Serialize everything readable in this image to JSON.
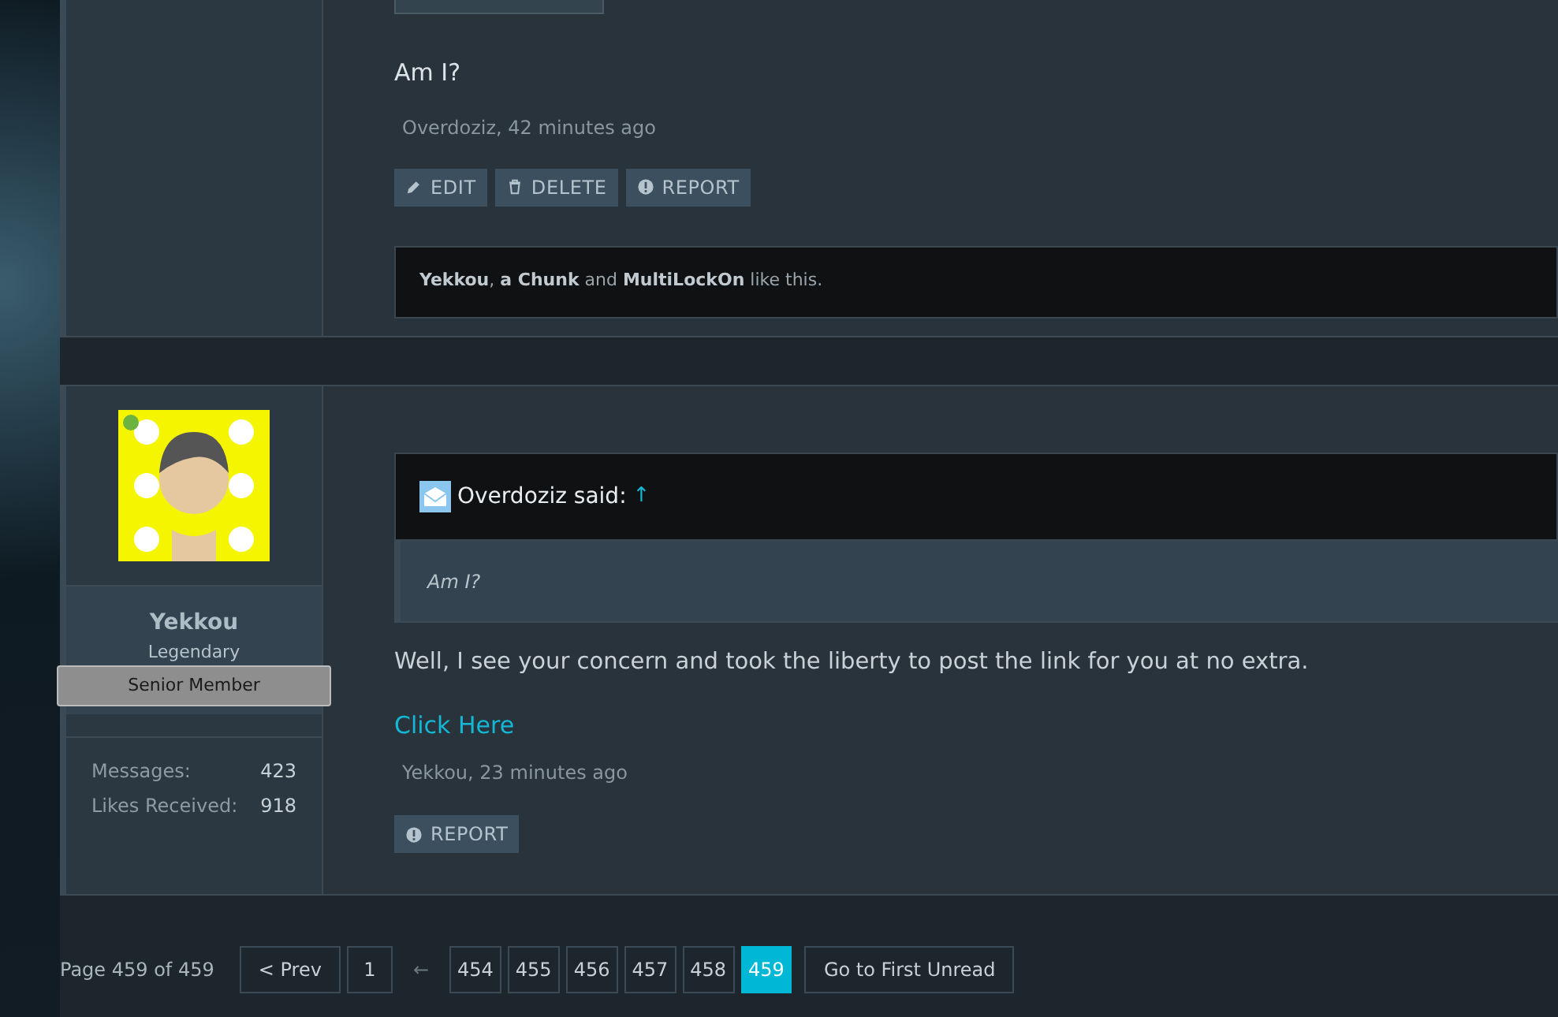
{
  "previous_post": {
    "body": "Am I?",
    "meta": "Overdoziz, 42 minutes ago",
    "actions": [
      {
        "kind": "edit",
        "label": "EDIT"
      },
      {
        "kind": "delete",
        "label": "DELETE"
      },
      {
        "kind": "report",
        "label": "REPORT"
      }
    ],
    "likes": "**Yekkou**, **a Chunk** and **MultiLockOn** like this."
  },
  "post": {
    "user": {
      "name": "Yekkou",
      "title": "Legendary",
      "banner": "Senior Member",
      "online": true,
      "stats": [
        {
          "label": "Messages:",
          "value": "423"
        },
        {
          "label": "Likes Received:",
          "value": "918"
        }
      ]
    },
    "quote": {
      "author": "Overdoziz said:",
      "arrow": "↑",
      "text": "Am I?"
    },
    "body": "Well, I see your concern and took the liberty to post the link for you at no extra.",
    "link": "Click Here",
    "meta": "Yekkou, 23 minutes ago",
    "actions": [
      {
        "kind": "report",
        "label": "REPORT"
      }
    ]
  },
  "pagination": {
    "label": "Page 459 of 459",
    "items": [
      {
        "kind": "button",
        "label": "< Prev",
        "selected": false
      },
      {
        "kind": "page",
        "label": "1",
        "selected": false
      },
      {
        "kind": "gap",
        "label": "←"
      },
      {
        "kind": "page",
        "label": "454",
        "selected": false
      },
      {
        "kind": "page",
        "label": "455",
        "selected": false
      },
      {
        "kind": "page",
        "label": "456",
        "selected": false
      },
      {
        "kind": "page",
        "label": "457",
        "selected": false
      },
      {
        "kind": "page",
        "label": "458",
        "selected": false
      },
      {
        "kind": "page",
        "label": "459",
        "selected": true
      },
      {
        "kind": "button",
        "label": "Go to First Unread",
        "selected": false
      }
    ]
  }
}
